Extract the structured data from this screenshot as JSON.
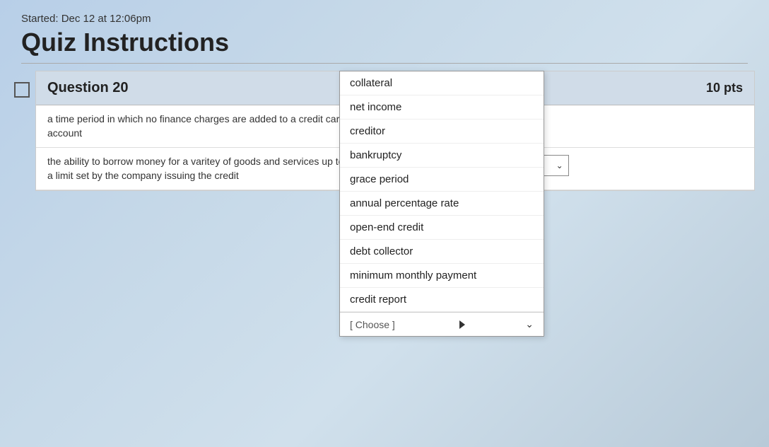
{
  "header": {
    "started_label": "Started: Dec 12 at 12:06pm",
    "quiz_title": "Quiz Instructions"
  },
  "question": {
    "number_label": "Question 20",
    "points_label": "10 pts"
  },
  "dropdown_items": [
    "collateral",
    "net income",
    "creditor",
    "bankruptcy",
    "grace period",
    "annual percentage rate",
    "open-end credit",
    "debt collector",
    "minimum monthly payment",
    "credit report"
  ],
  "choose_label": "[ Choose ]",
  "rows": [
    {
      "definition": "a time period in which no finance charges are added to a credit card account",
      "answer": "[ Choose ]"
    },
    {
      "definition": "the ability to borrow money for a varitey of goods and services up to a limit set by the company issuing the credit",
      "answer": "[ Choose ]"
    }
  ]
}
